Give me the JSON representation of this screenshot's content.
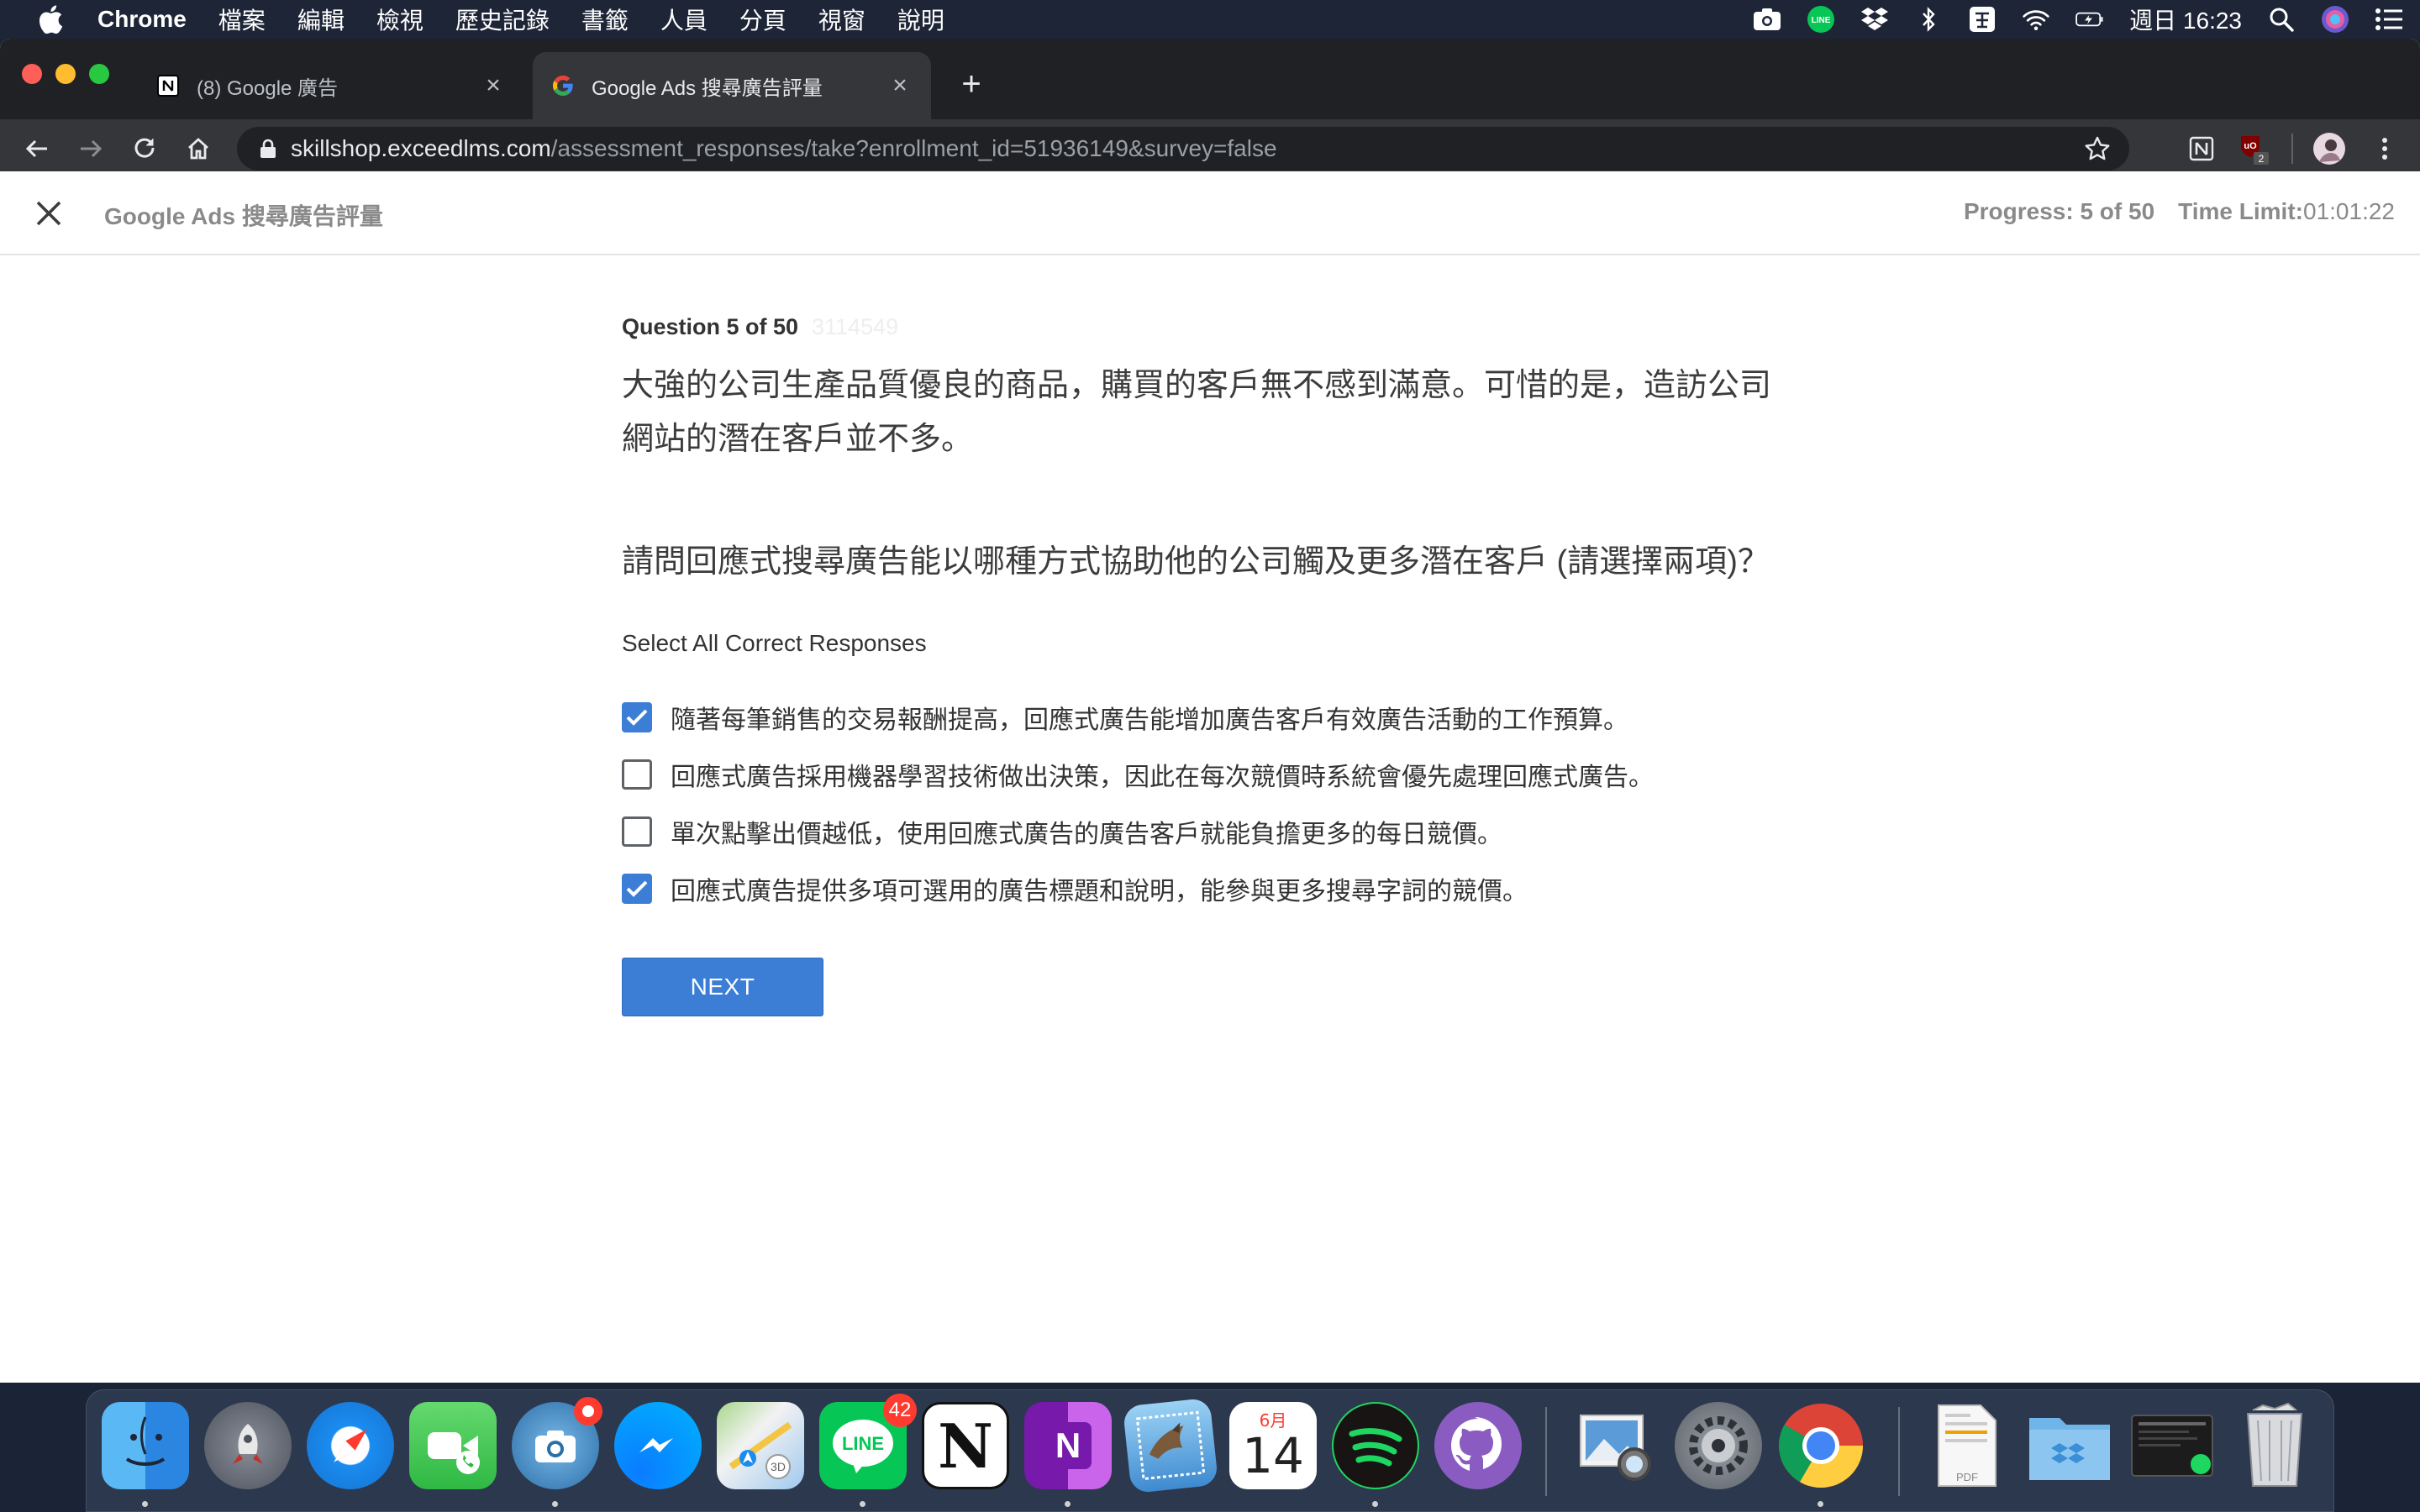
{
  "menubar": {
    "app_name": "Chrome",
    "items": [
      "檔案",
      "編輯",
      "檢視",
      "歷史記錄",
      "書籤",
      "人員",
      "分頁",
      "視窗",
      "說明"
    ],
    "clock": "週日 16:23",
    "icons": [
      "screenshot-icon",
      "line-icon",
      "dropbox-icon",
      "bluetooth-icon",
      "input-method-icon",
      "wifi-icon",
      "battery-icon",
      "spotlight-icon",
      "siri-icon",
      "control-center-icon"
    ]
  },
  "browser": {
    "tabs": [
      {
        "title": "(8) Google 廣告",
        "icon": "notion-icon"
      },
      {
        "title": "Google Ads 搜尋廣告評量",
        "icon": "google-icon"
      }
    ],
    "url_host": "skillshop.exceedlms.com",
    "url_path": "/assessment_responses/take?enrollment_id=51936149&survey=false",
    "ublock_badge": "2"
  },
  "page": {
    "course_title": "Google Ads 搜尋廣告評量",
    "progress_label": "Progress:",
    "progress_value": "5 of 50",
    "time_limit_label": "Time Limit:",
    "time_limit_value": "01:01:22",
    "progress_fraction": 0.1
  },
  "question": {
    "number_label": "Question 5 of 50",
    "id": "3114549",
    "stem": "大強的公司生產品質優良的商品，購買的客戶無不感到滿意。可惜的是，造訪公司網站的潛在客戶並不多。",
    "ask": "請問回應式搜尋廣告能以哪種方式協助他的公司觸及更多潛在客戶 (請選擇兩項)？",
    "instruction": "Select All Correct Responses",
    "options": [
      {
        "text": "隨著每筆銷售的交易報酬提高，回應式廣告能增加廣告客戶有效廣告活動的工作預算。",
        "checked": true
      },
      {
        "text": "回應式廣告採用機器學習技術做出決策，因此在每次競價時系統會優先處理回應式廣告。",
        "checked": false
      },
      {
        "text": "單次點擊出價越低，使用回應式廣告的廣告客戶就能負擔更多的每日競價。",
        "checked": false
      },
      {
        "text": "回應式廣告提供多項可選用的廣告標題和說明，能參與更多搜尋字詞的競價。",
        "checked": true
      }
    ],
    "next_label": "NEXT"
  },
  "dock": {
    "calendar_month": "6月",
    "calendar_day": "14",
    "line_badge": "42",
    "onenote_letter": "N",
    "notion_letter": "N",
    "line_label": "LINE",
    "pdf_label": "PDF",
    "apps": [
      "finder",
      "launchpad",
      "safari",
      "facetime",
      "screenshot",
      "messenger",
      "maps",
      "line",
      "notion",
      "onenote",
      "preview-mail",
      "calendar",
      "spotify",
      "github-desktop",
      "preview",
      "system-preferences",
      "chrome",
      "pdf-document",
      "dropbox-folder",
      "activity-monitor",
      "trash"
    ]
  },
  "colors": {
    "accent": "#3c7dd6",
    "menubar_bg": "#1d2537",
    "tab_bg": "#202124",
    "toolbar_bg": "#35363a"
  }
}
